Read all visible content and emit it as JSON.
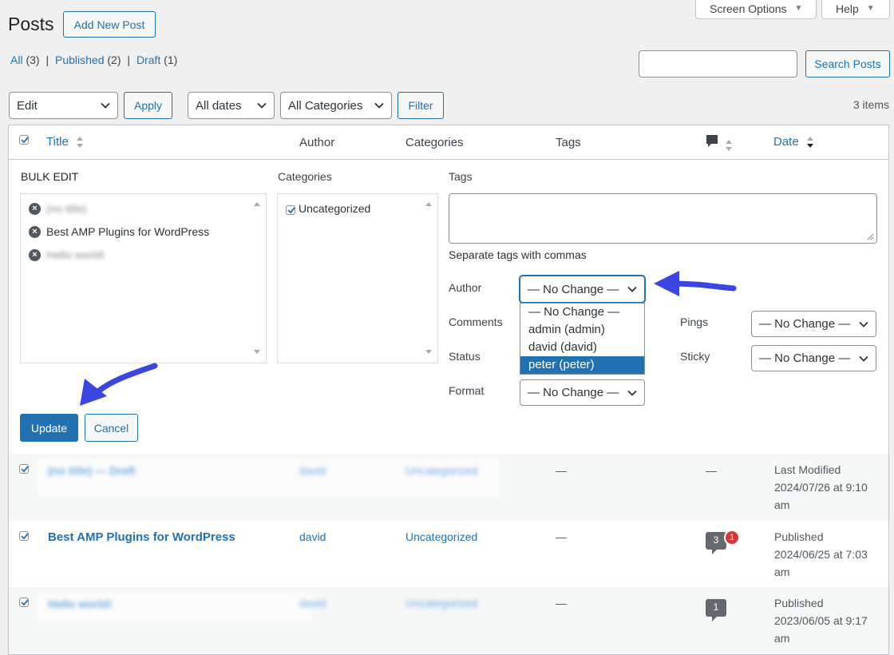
{
  "header": {
    "title": "Posts",
    "add_new": "Add New Post",
    "screen_options": "Screen Options",
    "help": "Help"
  },
  "views": {
    "all": "All",
    "all_count": "(3)",
    "published": "Published",
    "published_count": "(2)",
    "draft": "Draft",
    "draft_count": "(1)",
    "sep": "|"
  },
  "search": {
    "placeholder": "",
    "button": "Search Posts"
  },
  "toolbar": {
    "bulk_action": "Edit",
    "apply": "Apply",
    "dates": "All dates",
    "categories": "All Categories",
    "filter": "Filter",
    "items_count": "3 items"
  },
  "columns": {
    "title": "Title",
    "author": "Author",
    "categories": "Categories",
    "tags": "Tags",
    "date": "Date"
  },
  "bulk_edit": {
    "heading": "BULK EDIT",
    "posts": [
      "(no title)",
      "Best AMP Plugins for WordPress",
      "Hello world!"
    ],
    "categories_label": "Categories",
    "category_option": "Uncategorized",
    "tags_label": "Tags",
    "tags_hint": "Separate tags with commas",
    "author_label": "Author",
    "author_value": "— No Change —",
    "author_options": [
      "— No Change —",
      "admin (admin)",
      "david (david)",
      "peter (peter)"
    ],
    "comments_label": "Comments",
    "status_label": "Status",
    "format_label": "Format",
    "format_value": "— No Change —",
    "pings_label": "Pings",
    "pings_value": "— No Change —",
    "sticky_label": "Sticky",
    "sticky_value": "— No Change —",
    "update": "Update",
    "cancel": "Cancel"
  },
  "rows": [
    {
      "title": "(no title) — Draft",
      "author": "david",
      "category": "Uncategorized",
      "tags": "—",
      "comments": "—",
      "date_status": "Last Modified",
      "date_line1": "2024/07/26 at 9:10",
      "date_line2": "am"
    },
    {
      "title": "Best AMP Plugins for WordPress",
      "author": "david",
      "category": "Uncategorized",
      "tags": "—",
      "comments": "3",
      "pending": "1",
      "date_status": "Published",
      "date_line1": "2024/06/25 at 7:03",
      "date_line2": "am"
    },
    {
      "title": "Hello world!",
      "author": "david",
      "category": "Uncategorized",
      "tags": "—",
      "comments": "1",
      "date_status": "Published",
      "date_line1": "2023/06/05 at 9:17",
      "date_line2": "am"
    }
  ],
  "colors": {
    "accent": "#2271b1",
    "arrow": "#3b46e0",
    "highlight": "#2271b1",
    "badge_red": "#d63638"
  }
}
